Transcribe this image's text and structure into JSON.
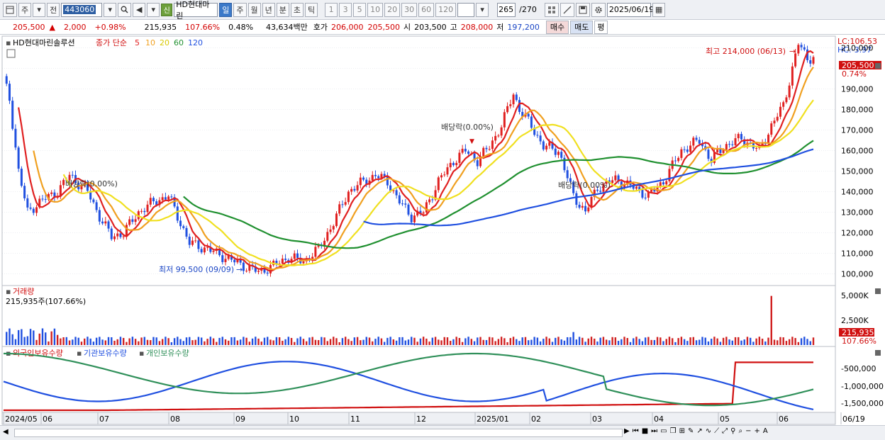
{
  "toolbar": {
    "market_type": "주",
    "prev_label": "전",
    "stock_code": "443060",
    "badge": "신",
    "stock_name": "HD현대마린",
    "period_buttons": [
      "일",
      "주",
      "월",
      "년",
      "분",
      "초",
      "틱"
    ],
    "active_period": "일",
    "interval_buttons": [
      "1",
      "3",
      "5",
      "10",
      "20",
      "30",
      "60",
      "120"
    ],
    "count_display": "265",
    "count_total": "/270",
    "date": "2025/06/19"
  },
  "quote": {
    "price": "205,500",
    "change_arrow": "▲",
    "change": "2,000",
    "change_pct": "+0.98%",
    "volume": "215,935",
    "volume_ratio": "107.66%",
    "turnover": "0.48%",
    "amount": "43,634백만",
    "ask_label": "호가",
    "ask": "206,000",
    "bid": "205,500",
    "open_label": "시",
    "open": "203,500",
    "high_label": "고",
    "high": "208,000",
    "low_label": "저",
    "low": "197,200",
    "buy_label": "매수",
    "sell_label": "매도",
    "flat_label": "평"
  },
  "price_panel": {
    "name_label": "HD현대마린솔루션",
    "legend_prefix": "종가 단순",
    "ma_periods": [
      "5",
      "10",
      "20",
      "60",
      "120"
    ],
    "ma_colors": [
      "#e02020",
      "#f0a020",
      "#f0e020",
      "#209030",
      "#2050e0"
    ],
    "lc_label": "LC:106.53",
    "hc_label": "HC:-3.97",
    "current_price_tag": "205,500",
    "current_pct_tag": "0.74%",
    "high_annotation": "최고 214,000 (06/13)",
    "low_annotation": "최저 99,500 (09/09)",
    "dividend_annotations": [
      "배당락(0.00%)",
      "배당락(0.00%)",
      "배당락(0.00%)"
    ],
    "y_ticks": [
      "210,000",
      "200,000",
      "190,000",
      "180,000",
      "170,000",
      "160,000",
      "150,000",
      "140,000",
      "130,000",
      "120,000",
      "110,000",
      "100,000"
    ]
  },
  "volume_panel": {
    "title": "거래량",
    "subtitle": "215,935주(107.66%)",
    "y_ticks": [
      "5,000K",
      "2,500K"
    ],
    "current_tag": "215,935",
    "pct_tag": "107.66%"
  },
  "holding_panel": {
    "legend": [
      "외국인보유수량",
      "기관보유수량",
      "개인보유수량"
    ],
    "legend_colors": [
      "#d01010",
      "#2050e0",
      "#30905a"
    ],
    "y_ticks": [
      "-500,000",
      "-1,000,000",
      "-1,500,000"
    ]
  },
  "x_axis": {
    "labels": [
      "2024/05",
      "06",
      "07",
      "08",
      "09",
      "10",
      "11",
      "12",
      "2025/01",
      "02",
      "03",
      "04",
      "05",
      "06",
      "06/19"
    ]
  },
  "chart_data": {
    "type": "candlestick",
    "title": "HD현대마린솔루션",
    "ylim": [
      95000,
      215000
    ],
    "close_path": [
      [
        0,
        195000
      ],
      [
        2,
        185000
      ],
      [
        5,
        150000
      ],
      [
        8,
        130000
      ],
      [
        12,
        135000
      ],
      [
        18,
        140000
      ],
      [
        22,
        148000
      ],
      [
        28,
        140000
      ],
      [
        32,
        128000
      ],
      [
        36,
        118000
      ],
      [
        40,
        120000
      ],
      [
        45,
        130000
      ],
      [
        50,
        135000
      ],
      [
        55,
        138000
      ],
      [
        58,
        128000
      ],
      [
        62,
        115000
      ],
      [
        68,
        112000
      ],
      [
        74,
        108000
      ],
      [
        80,
        104000
      ],
      [
        85,
        101000
      ],
      [
        90,
        104000
      ],
      [
        95,
        108000
      ],
      [
        100,
        106000
      ],
      [
        105,
        112000
      ],
      [
        110,
        125000
      ],
      [
        115,
        140000
      ],
      [
        120,
        145000
      ],
      [
        124,
        148000
      ],
      [
        128,
        145000
      ],
      [
        132,
        135000
      ],
      [
        136,
        128000
      ],
      [
        140,
        130000
      ],
      [
        145,
        145000
      ],
      [
        150,
        155000
      ],
      [
        154,
        160000
      ],
      [
        158,
        155000
      ],
      [
        162,
        162000
      ],
      [
        166,
        172000
      ],
      [
        170,
        188000
      ],
      [
        172,
        180000
      ],
      [
        176,
        172000
      ],
      [
        180,
        162000
      ],
      [
        185,
        160000
      ],
      [
        190,
        138000
      ],
      [
        194,
        130000
      ],
      [
        198,
        142000
      ],
      [
        204,
        146000
      ],
      [
        210,
        142000
      ],
      [
        215,
        138000
      ],
      [
        220,
        145000
      ],
      [
        226,
        160000
      ],
      [
        232,
        165000
      ],
      [
        236,
        155000
      ],
      [
        240,
        162000
      ],
      [
        246,
        166000
      ],
      [
        252,
        160000
      ],
      [
        256,
        172000
      ],
      [
        260,
        182000
      ],
      [
        263,
        200000
      ],
      [
        265,
        212000
      ],
      [
        268,
        205000
      ],
      [
        270,
        205500
      ]
    ],
    "volume_spikes": [
      {
        "x": 190,
        "value": 1400000
      },
      {
        "x": 256,
        "value": 5300000
      }
    ]
  }
}
